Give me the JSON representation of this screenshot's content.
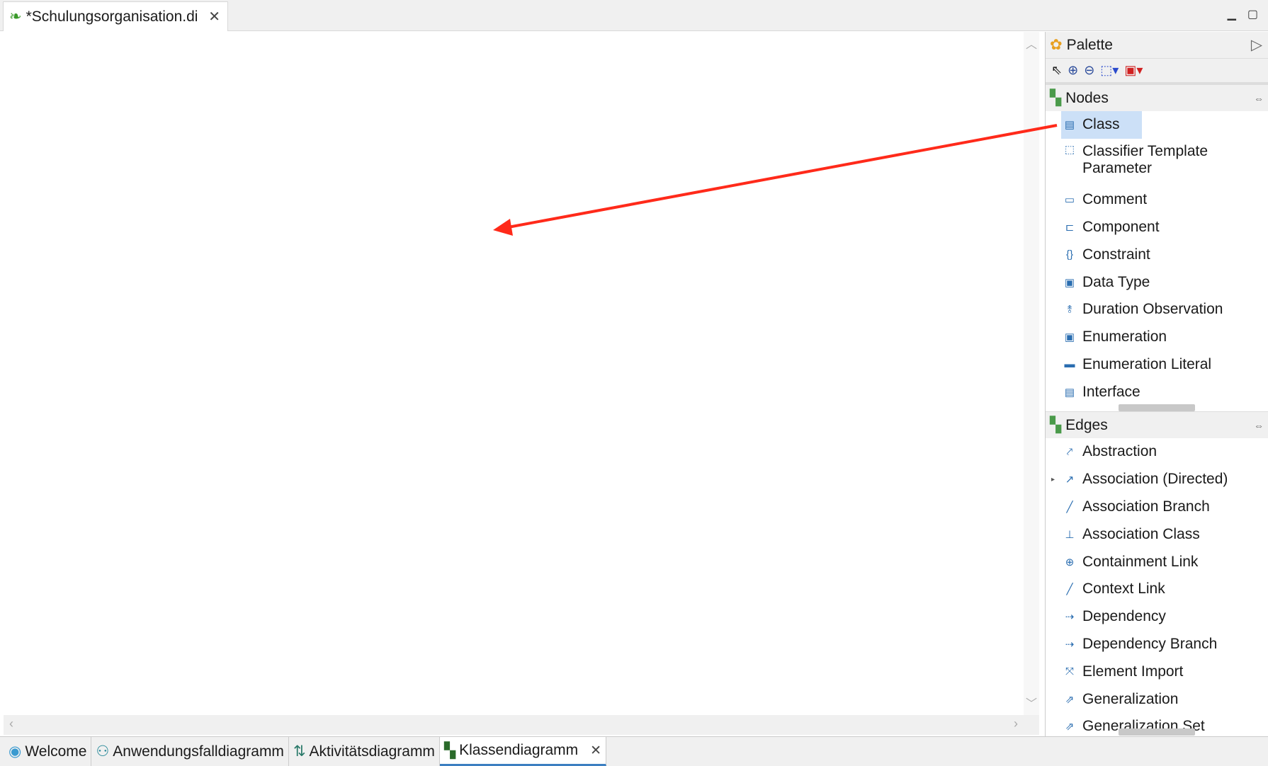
{
  "editor_tab": {
    "title": "*Schulungsorganisation.di",
    "icon": "papyrus-leaf-icon"
  },
  "palette": {
    "title": "Palette",
    "nodes": {
      "title": "Nodes",
      "items": [
        "Class",
        "Classifier Template Parameter",
        "Comment",
        "Component",
        "Constraint",
        "Data Type",
        "Duration Observation",
        "Enumeration",
        "Enumeration Literal",
        "Interface"
      ],
      "selected": "Class"
    },
    "edges": {
      "title": "Edges",
      "items": [
        "Abstraction",
        "Association (Directed)",
        "Association Branch",
        "Association Class",
        "Containment Link",
        "Context Link",
        "Dependency",
        "Dependency Branch",
        "Element Import",
        "Generalization",
        "Generalization Set"
      ]
    }
  },
  "bottom_tabs": [
    {
      "label": "Welcome"
    },
    {
      "label": "Anwendungsfalldiagramm"
    },
    {
      "label": "Aktivitätsdiagramm"
    },
    {
      "label": "Klassendiagramm",
      "active": true
    }
  ],
  "colors": {
    "annotation_arrow": "#ff2a1a",
    "selection": "#cce0f7",
    "active_tab_underline": "#3c7fc1"
  }
}
